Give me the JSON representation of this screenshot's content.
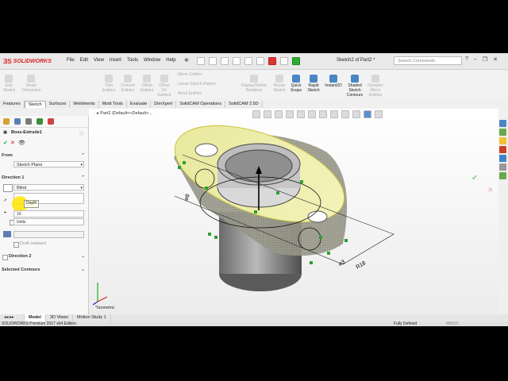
{
  "app": {
    "brand": "SOLIDWORKS",
    "document_title": "Sketch2 of Part2 *"
  },
  "menu": [
    "File",
    "Edit",
    "View",
    "Insert",
    "Tools",
    "Window",
    "Help"
  ],
  "search": {
    "placeholder": "Search Commands"
  },
  "ribbon": {
    "tools": [
      {
        "label": "Exit\nSketch",
        "state": "disabled"
      },
      {
        "label": "Smart\nDimension",
        "state": "disabled"
      },
      {
        "label": "Trim\nEntities",
        "state": "disabled"
      },
      {
        "label": "Convert\nEntities",
        "state": "disabled"
      },
      {
        "label": "Offset\nEntities",
        "state": "disabled"
      },
      {
        "label": "Offset\nOn\nSurface",
        "state": "disabled"
      },
      {
        "label": "Display/Delete\nRelations",
        "state": "disabled"
      },
      {
        "label": "Repair\nSketch",
        "state": "disabled"
      },
      {
        "label": "Quick\nSnaps",
        "state": "active"
      },
      {
        "label": "Rapid\nSketch",
        "state": "active"
      },
      {
        "label": "Instant2D",
        "state": "active"
      },
      {
        "label": "Shaded\nSketch\nContours",
        "state": "active"
      },
      {
        "label": "Dynamic\nMirror\nEntities",
        "state": "disabled"
      }
    ],
    "small": [
      "Mirror Entities",
      "Linear Sketch Pattern",
      "Move Entities"
    ]
  },
  "tabs": [
    "Features",
    "Sketch",
    "Surfaces",
    "Weldments",
    "Mold Tools",
    "Evaluate",
    "DimXpert",
    "SolidCAM Operations",
    "SolidCAM 2.5D"
  ],
  "active_tab": "Sketch",
  "panel": {
    "feature_name": "Boss-Extrude1",
    "from_label": "From",
    "from_value": "Sketch Plane",
    "direction1_label": "Direction 1",
    "direction1_type": "Blind",
    "depth_tooltip": "Depth",
    "depth_value": "10",
    "units_label": "Units",
    "draft_outward_label": "Draft outward",
    "direction2_label": "Direction 2",
    "selected_contours_label": "Selected Contours"
  },
  "viewport": {
    "breadcrumb": "Part2  (Default<<Default>...",
    "view_label": "*Isometric",
    "dimensions": [
      "⌀8",
      "R18",
      "⌀3"
    ]
  },
  "bottom_tabs": [
    "Model",
    "3D Views",
    "Motion Study 1"
  ],
  "status": {
    "edition": "SOLIDWORKS Premium 2017 x64 Edition",
    "sketch_state": "Fully Defined",
    "units": "MMGS"
  },
  "colors": {
    "accent": "#4a86c6",
    "highlight": "#ffe600",
    "profile_fill": "#eaea7a"
  }
}
